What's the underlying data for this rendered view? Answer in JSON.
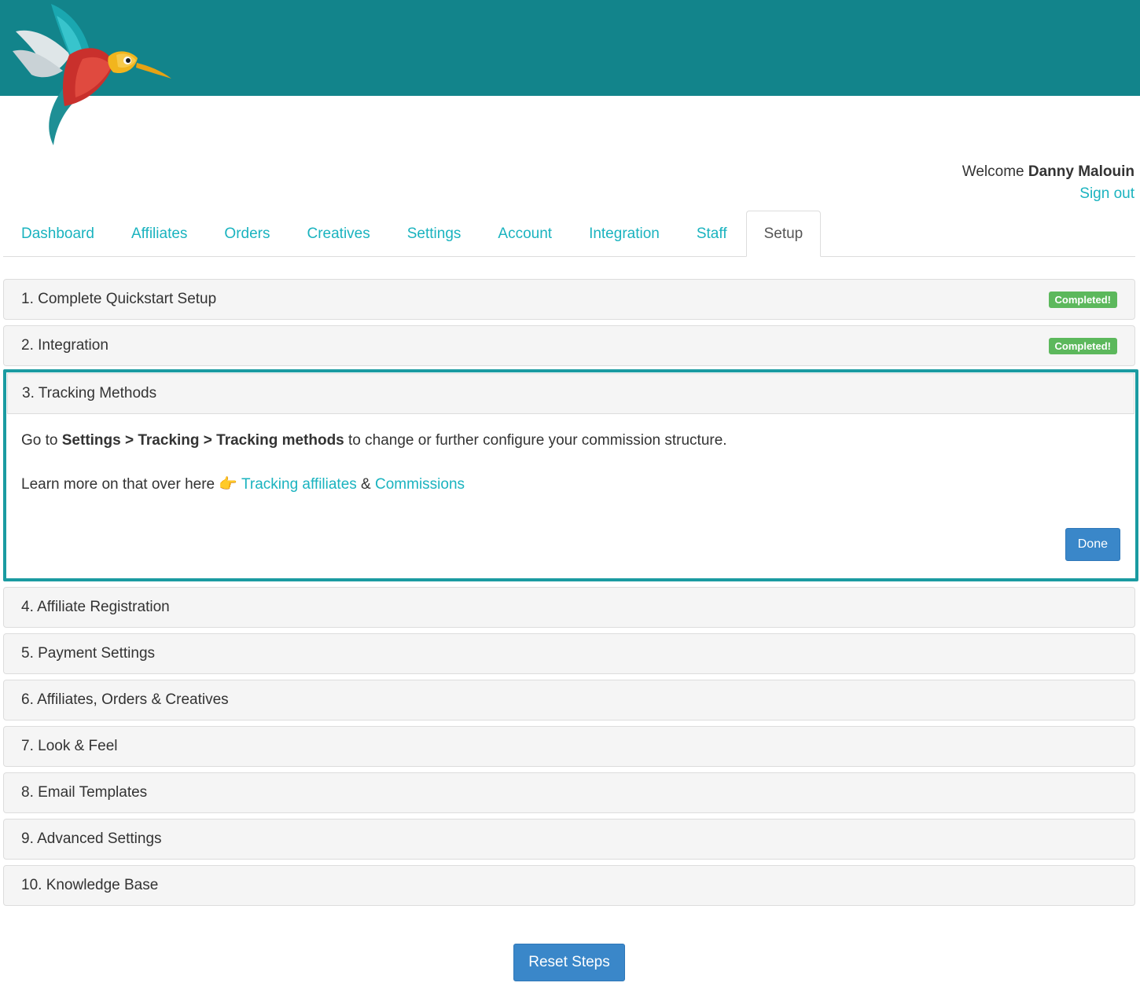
{
  "header": {
    "welcome_prefix": "Welcome ",
    "user_name": "Danny Malouin",
    "sign_out": "Sign out"
  },
  "tabs": [
    {
      "label": "Dashboard",
      "active": false
    },
    {
      "label": "Affiliates",
      "active": false
    },
    {
      "label": "Orders",
      "active": false
    },
    {
      "label": "Creatives",
      "active": false
    },
    {
      "label": "Settings",
      "active": false
    },
    {
      "label": "Account",
      "active": false
    },
    {
      "label": "Integration",
      "active": false
    },
    {
      "label": "Staff",
      "active": false
    },
    {
      "label": "Setup",
      "active": true
    }
  ],
  "steps": {
    "s1": {
      "title": "1. Complete Quickstart Setup",
      "badge": "Completed!"
    },
    "s2": {
      "title": "2. Integration",
      "badge": "Completed!"
    },
    "s3": {
      "title": "3. Tracking Methods",
      "line1_prefix": "Go to ",
      "line1_path": "Settings > Tracking > Tracking methods",
      "line1_suffix": " to change or further configure your commission structure.",
      "line2_prefix": "Learn more on that over here ",
      "pointing_emoji": "👉",
      "link1": "Tracking affiliates",
      "amp": " & ",
      "link2": "Commissions",
      "done_label": "Done"
    },
    "s4": {
      "title": "4. Affiliate Registration"
    },
    "s5": {
      "title": "5. Payment Settings"
    },
    "s6": {
      "title": "6. Affiliates, Orders & Creatives"
    },
    "s7": {
      "title": "7. Look & Feel"
    },
    "s8": {
      "title": "8. Email Templates"
    },
    "s9": {
      "title": "9. Advanced Settings"
    },
    "s10": {
      "title": "10. Knowledge Base"
    }
  },
  "reset_label": "Reset Steps",
  "colors": {
    "topbar": "#12848b",
    "link": "#1ab3bf",
    "badge_green": "#5cb85c",
    "button_blue": "#3a87c9",
    "active_panel_border": "#1a9ba1"
  }
}
